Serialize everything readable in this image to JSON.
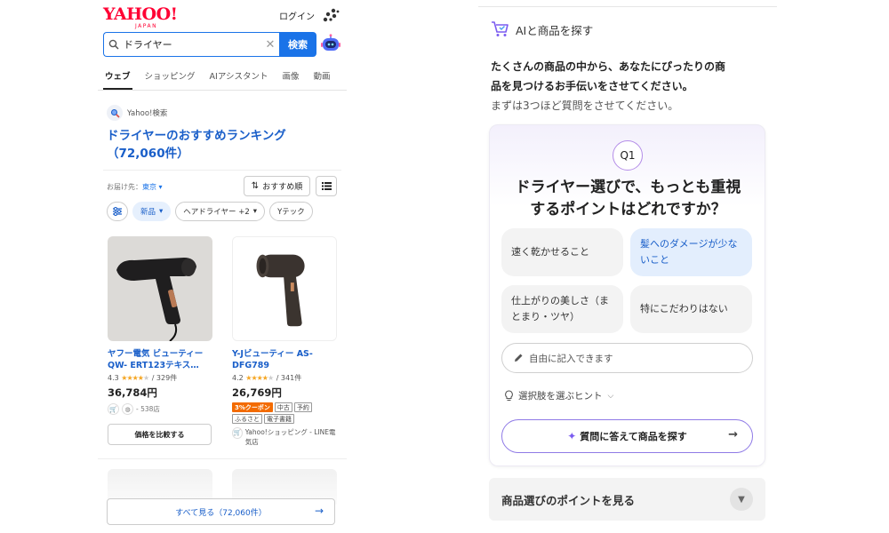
{
  "left": {
    "logo_text": "YAHOO!",
    "logo_sub": "JAPAN",
    "login_label": "ログイン",
    "search": {
      "value": "ドライヤー",
      "button_label": "検索"
    },
    "tabs": [
      "ウェブ",
      "ショッピング",
      "AIアシスタント",
      "画像",
      "動画"
    ],
    "source_label": "Yahoo!検索",
    "ranking_title": "ドライヤーのおすすめランキング（72,060件）",
    "delivery_label": "お届け先：",
    "delivery_value": "東京",
    "sort_label": "おすすめ順",
    "chips": [
      "新品",
      "ヘアドライヤー +2",
      "Yテック"
    ],
    "products": [
      {
        "name": "ヤフー電気 ビューティー QW- ERT123テキス…",
        "rating": "4.3",
        "reviews": "/ 329件",
        "price": "36,784円",
        "stores": "- 538店",
        "compare_label": "価格を比較する"
      },
      {
        "name": "Y-Jビューティー AS-DFG789",
        "rating": "4.2",
        "reviews": "/ 341件",
        "price": "26,769円",
        "coupon": "3%クーポン",
        "tag_used": "中古",
        "tag_reserve": "予約",
        "tag_furusato": "ふるさと",
        "tag_ebook": "電子書籍",
        "shop": "Yahoo!ショッピング - LINE電気店"
      }
    ],
    "see_all_label": "すべて見る（72,060件）"
  },
  "right": {
    "header": "AIと商品を探す",
    "intro_line1": "たくさんの商品の中から、あなたにぴったりの商",
    "intro_line2": "品を見つけるお手伝いをさせてください。",
    "intro_line3": "まずは3つほど質問をさせてください。",
    "question_badge": "Q1",
    "question_line1": "ドライヤー選びで、もっとも重視",
    "question_line2": "するポイントはどれですか？",
    "options": [
      "速く乾かせること",
      "髪へのダメージが少ないこと",
      "仕上がりの美しさ（まとまり・ツヤ）",
      "特にこだわりはない"
    ],
    "free_input_placeholder": "自由に記入できます",
    "hint_label": "選択肢を選ぶヒント",
    "ask_button_label": "質問に答えて商品を探す",
    "points_label": "商品選びのポイントを見る"
  },
  "colors": {
    "brand_red": "#ff0033",
    "link_blue": "#1a5fc9",
    "search_blue": "#1a73e8",
    "star": "#f5a623",
    "coupon_orange": "#f36b00",
    "ai_purple": "#8f7ae6"
  }
}
